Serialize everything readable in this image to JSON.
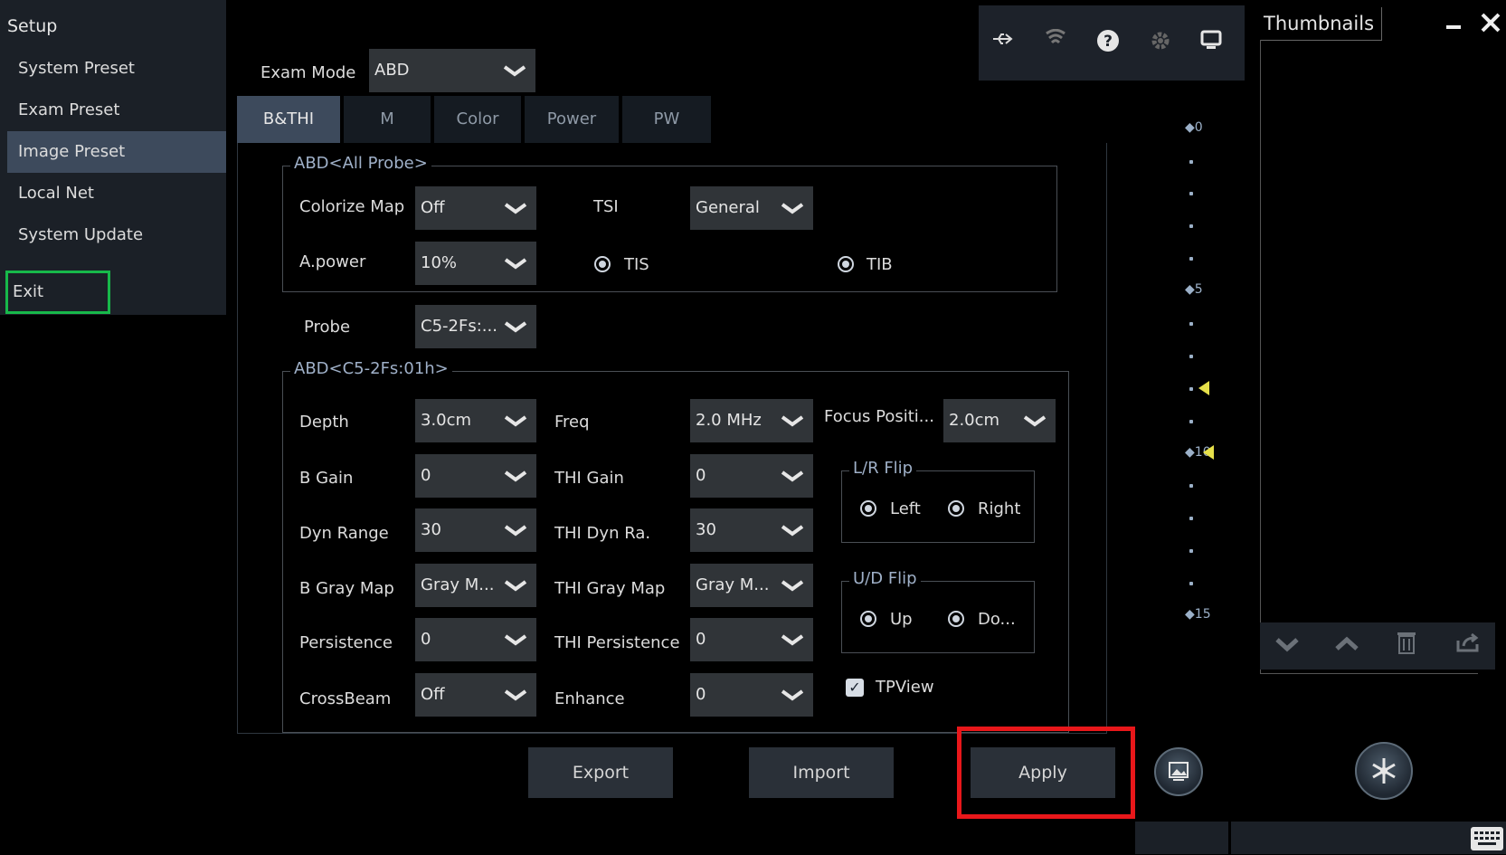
{
  "sidebar": {
    "title": "Setup",
    "items": [
      {
        "label": "System Preset"
      },
      {
        "label": "Exam Preset"
      },
      {
        "label": "Image Preset"
      },
      {
        "label": "Local Net"
      },
      {
        "label": "System  Update"
      },
      {
        "label": "Exit"
      }
    ]
  },
  "thumbnails": {
    "title": "Thumbnails"
  },
  "exam_mode": {
    "label": "Exam Mode",
    "value": "ABD"
  },
  "tabs": [
    "B&THI",
    "M",
    "Color",
    "Power",
    "PW"
  ],
  "group_all": {
    "title": "ABD<All Probe>",
    "colorize_map": {
      "label": "Colorize Map",
      "value": "Off"
    },
    "tsi": {
      "label": "TSI",
      "value": "General"
    },
    "apower": {
      "label": "A.power",
      "value": "10%"
    },
    "tis": {
      "label": "TIS"
    },
    "tib": {
      "label": "TIB"
    }
  },
  "probe": {
    "label": "Probe",
    "value": "C5-2Fs:..."
  },
  "group_probe": {
    "title": "ABD<C5-2Fs:01h>",
    "depth": {
      "label": "Depth",
      "value": "3.0cm"
    },
    "freq": {
      "label": "Freq",
      "value": "2.0 MHz"
    },
    "focus": {
      "label": "Focus Positi...",
      "value": "2.0cm"
    },
    "b_gain": {
      "label": "B Gain",
      "value": "0"
    },
    "thi_gain": {
      "label": "THI Gain",
      "value": "0"
    },
    "dyn_range": {
      "label": "Dyn Range",
      "value": "30"
    },
    "thi_dyn": {
      "label": "THI Dyn Ra.",
      "value": "30"
    },
    "b_gray": {
      "label": "B Gray Map",
      "value": "Gray M..."
    },
    "thi_gray": {
      "label": "THI Gray Map",
      "value": "Gray M..."
    },
    "persistence": {
      "label": "Persistence",
      "value": "0"
    },
    "thi_persistence": {
      "label": "THI Persistence",
      "value": "0"
    },
    "crossbeam": {
      "label": "CrossBeam",
      "value": "Off"
    },
    "enhance": {
      "label": "Enhance",
      "value": "0"
    },
    "lr_flip": {
      "title": "L/R Flip",
      "left": "Left",
      "right": "Right"
    },
    "ud_flip": {
      "title": "U/D Flip",
      "up": "Up",
      "down": "Do..."
    },
    "tpview": {
      "label": "TPView",
      "checked": true
    }
  },
  "scale": {
    "labels": [
      "0",
      "5",
      "10",
      "15"
    ]
  },
  "buttons": {
    "export": "Export",
    "import": "Import",
    "apply": "Apply"
  },
  "colors": {
    "active_tab": "#3d4a5c",
    "exit_highlight": "#17b84a",
    "apply_highlight": "#e8171a",
    "marker": "#e6e04a"
  }
}
